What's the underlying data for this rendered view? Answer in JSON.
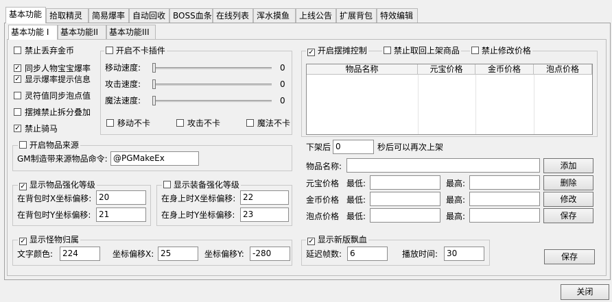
{
  "main_tabs": [
    "基本功能",
    "拾取精灵",
    "简易爆率",
    "自动回收",
    "BOSS血条",
    "在线列表",
    "浑水摸鱼",
    "上线公告",
    "扩展背包",
    "特效编辑"
  ],
  "sub_tabs": [
    "基本功能 I",
    "基本功能II",
    "基本功能III"
  ],
  "left_checks": [
    {
      "label": "禁止丢弃金币",
      "checked": false
    },
    {
      "label": "同步人物宝宝爆率",
      "checked": true
    },
    {
      "label": "显示爆率提示信息",
      "checked": true
    },
    {
      "label": "灵符值同步泡点值",
      "checked": false
    },
    {
      "label": "摆摊禁止拆分叠加",
      "checked": false
    },
    {
      "label": "禁止骑马",
      "checked": true
    }
  ],
  "nocard": {
    "title": "开启不卡插件",
    "checked": false,
    "sliders": [
      {
        "label": "移动速度:",
        "value": "0"
      },
      {
        "label": "攻击速度:",
        "value": "0"
      },
      {
        "label": "魔法速度:",
        "value": "0"
      }
    ],
    "checks": [
      {
        "label": "移动不卡",
        "checked": false
      },
      {
        "label": "攻击不卡",
        "checked": false
      },
      {
        "label": "魔法不卡",
        "checked": false
      }
    ]
  },
  "source": {
    "title": "开启物品来源",
    "checked": false,
    "cmd_label": "GM制造带来源物品命令:",
    "cmd_value": "@PGMakeEx"
  },
  "item_enhance": {
    "title": "显示物品强化等级",
    "checked": true,
    "x_label": "在背包时X坐标偏移:",
    "x_value": "20",
    "y_label": "在背包时Y坐标偏移:",
    "y_value": "21"
  },
  "equip_enhance": {
    "title": "显示装备强化等级",
    "checked": false,
    "x_label": "在身上时X坐标偏移:",
    "x_value": "22",
    "y_label": "在身上时Y坐标偏移:",
    "y_value": "23"
  },
  "monster": {
    "title": "显示怪物归属",
    "checked": true,
    "color_label": "文字颜色:",
    "color_value": "224",
    "x_label": "坐标偏移X:",
    "x_value": "25",
    "y_label": "坐标偏移Y:",
    "y_value": "-280"
  },
  "stall": {
    "enable_label": "开启摆摊控制",
    "enable_checked": true,
    "no_retrieve_label": "禁止取回上架商品",
    "no_retrieve_checked": false,
    "no_modify_label": "禁止修改价格",
    "no_modify_checked": false,
    "columns": [
      "物品名称",
      "元宝价格",
      "金币价格",
      "泡点价格"
    ],
    "rows": [],
    "relist_prefix": "下架后",
    "relist_value": "0",
    "relist_suffix": "秒后可以再次上架",
    "item_name_label": "物品名称:",
    "item_name_value": "",
    "price_rows": [
      {
        "label": "元宝价格",
        "min_label": "最低:",
        "min": "",
        "max_label": "最高:",
        "max": ""
      },
      {
        "label": "金币价格",
        "min_label": "最低:",
        "min": "",
        "max_label": "最高:",
        "max": ""
      },
      {
        "label": "泡点价格",
        "min_label": "最低:",
        "min": "",
        "max_label": "最高:",
        "max": ""
      }
    ],
    "buttons": [
      "添加",
      "删除",
      "修改",
      "保存"
    ]
  },
  "floating_blood": {
    "title": "显示新版飘血",
    "checked": true,
    "delay_label": "延迟帧数:",
    "delay_value": "6",
    "play_label": "播放时间:",
    "play_value": "30"
  },
  "save_label": "保存",
  "close_label": "关闭"
}
